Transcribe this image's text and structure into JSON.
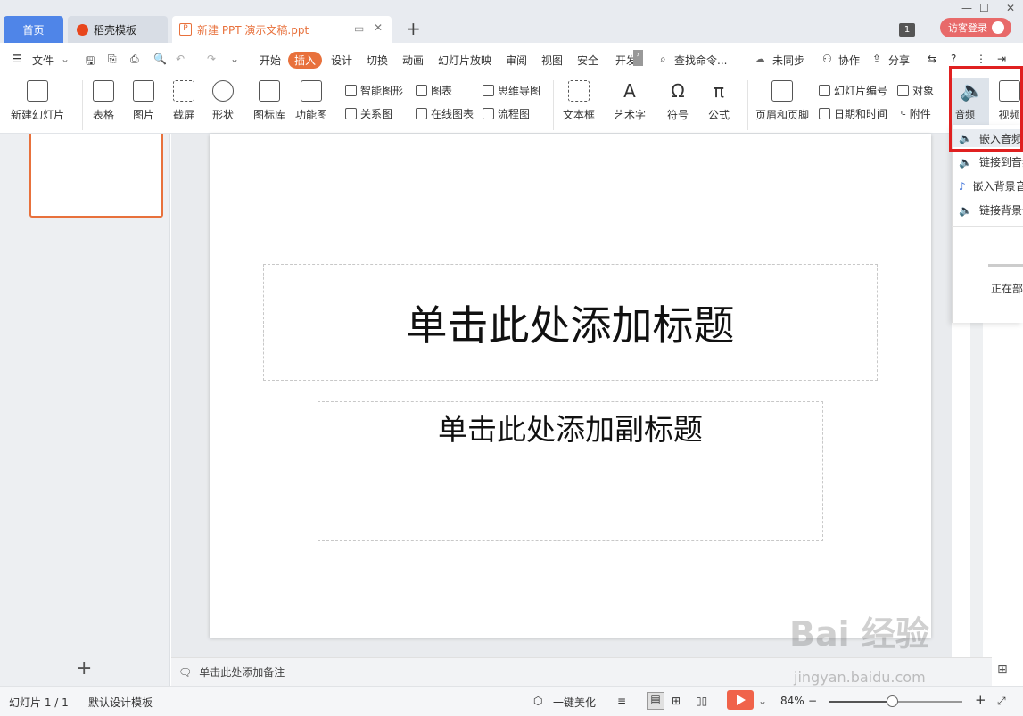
{
  "tabs": {
    "home": "首页",
    "template": "稻壳模板",
    "document": "新建 PPT 演示文稿.ppt",
    "new_tab": "+"
  },
  "titlebar": {
    "badge": "1",
    "login": "访客登录"
  },
  "menu": {
    "file": "文件",
    "items": [
      "开始",
      "插入",
      "设计",
      "切换",
      "动画",
      "幻灯片放映",
      "审阅",
      "视图",
      "安全",
      "开发"
    ],
    "active": "插入",
    "search": "查找命令...",
    "sync": "未同步",
    "collab": "协作",
    "share": "分享"
  },
  "ribbon": {
    "new_slide": "新建幻灯片",
    "table": "表格",
    "picture": "图片",
    "screenshot": "截屏",
    "shape": "形状",
    "icon_lib": "图标库",
    "function_chart": "功能图",
    "smart_shape": "智能图形",
    "chart": "图表",
    "mind_map": "思维导图",
    "relation": "关系图",
    "online_chart": "在线图表",
    "flowchart": "流程图",
    "textbox": "文本框",
    "art_text": "艺术字",
    "symbol": "符号",
    "formula": "公式",
    "header_footer": "页眉和页脚",
    "slide_number": "幻灯片编号",
    "object": "对象",
    "datetime": "日期和时间",
    "attachment": "附件",
    "audio": "音频",
    "video": "视频"
  },
  "audio_menu": {
    "items": [
      "嵌入音频",
      "链接到音频",
      "嵌入背景音乐",
      "链接背景音乐"
    ],
    "status": "正在部"
  },
  "slide": {
    "title_placeholder": "单击此处添加标题",
    "subtitle_placeholder": "单击此处添加副标题"
  },
  "notes": {
    "placeholder": "单击此处添加备注"
  },
  "status": {
    "slide_count": "幻灯片 1 / 1",
    "theme": "默认设计模板",
    "beautify": "一键美化",
    "zoom": "84%",
    "zoom_value": 0.47
  },
  "watermark": {
    "text": "Bai 经验",
    "url": "jingyan.baidu.com"
  }
}
